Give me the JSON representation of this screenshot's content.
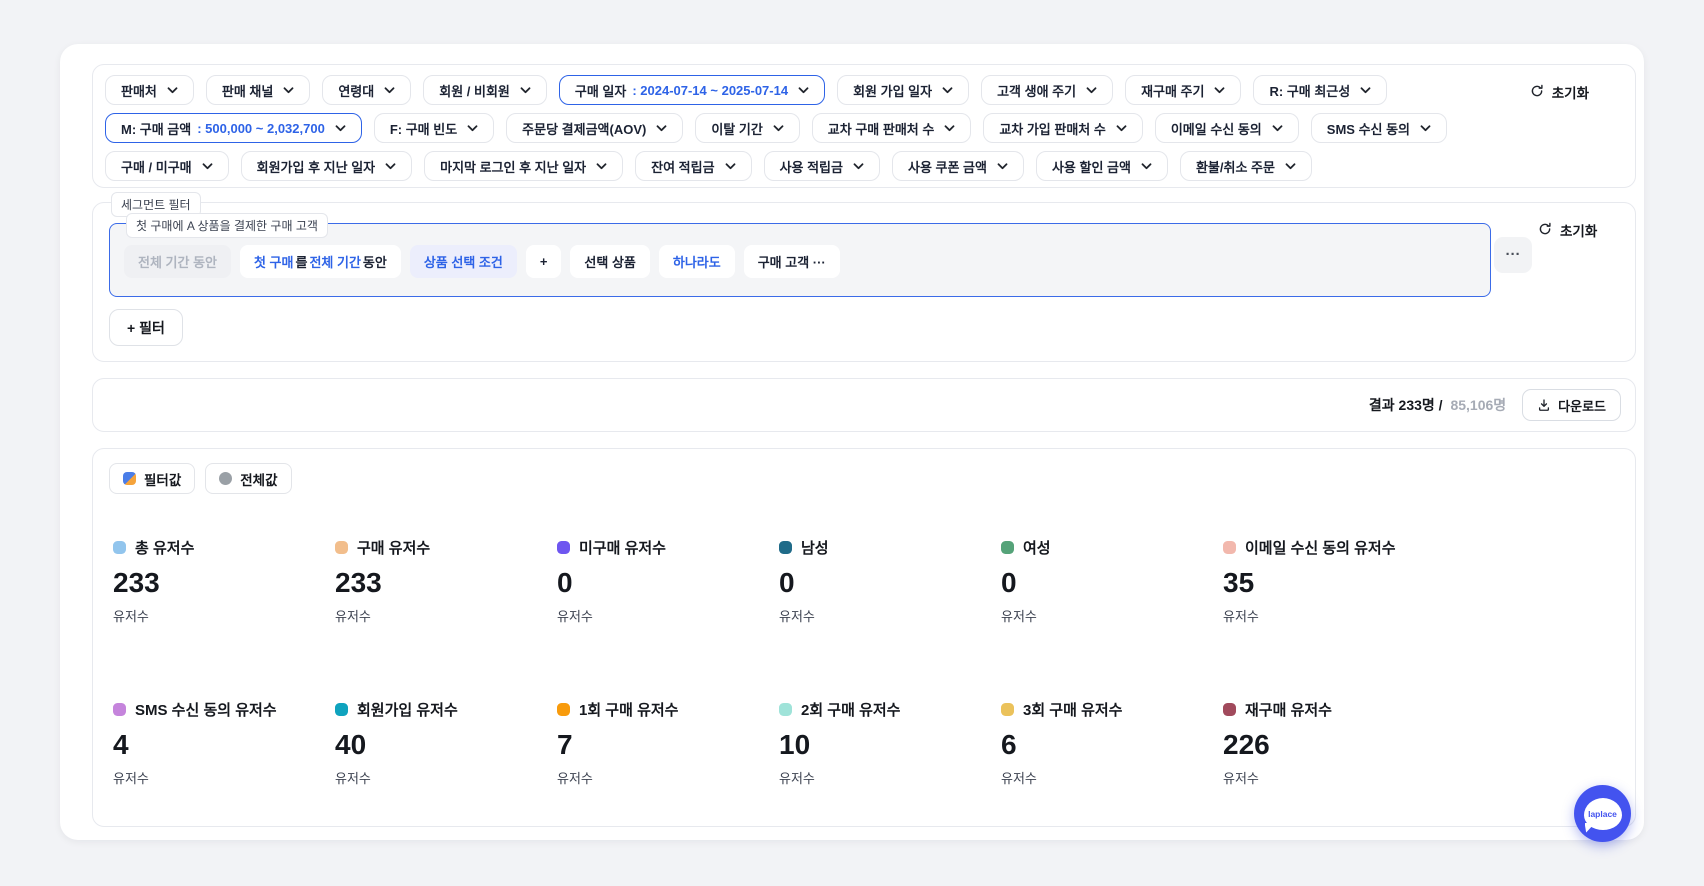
{
  "colors": {
    "accent_blue": "#2E63E7",
    "page_bg": "#F2F3F6",
    "segment_border": "#3B6BE8",
    "chat_fab": "#4353EF"
  },
  "filter_bar": {
    "reset_label": "초기화",
    "rows": [
      [
        {
          "label": "판매처"
        },
        {
          "label": "판매 채널"
        },
        {
          "label": "연령대"
        },
        {
          "label": "회원 / 비회원"
        },
        {
          "label": "구매 일자",
          "value": ": 2024-07-14 ~ 2025-07-14",
          "active": true
        },
        {
          "label": "회원 가입 일자"
        },
        {
          "label": "고객 생애 주기"
        },
        {
          "label": "재구매 주기"
        },
        {
          "label": "R: 구매 최근성"
        }
      ],
      [
        {
          "label": "M: 구매 금액",
          "value": ": 500,000 ~ 2,032,700",
          "active": true
        },
        {
          "label": "F: 구매 빈도"
        },
        {
          "label": "주문당 결제금액(AOV)"
        },
        {
          "label": "이탈 기간"
        },
        {
          "label": "교차 구매 판매처 수"
        },
        {
          "label": "교차 가입 판매처 수"
        },
        {
          "label": "이메일 수신 동의"
        },
        {
          "label": "SMS 수신 동의"
        }
      ],
      [
        {
          "label": "구매 / 미구매"
        },
        {
          "label": "회원가입 후 지난 일자"
        },
        {
          "label": "마지막 로그인 후 지난 일자"
        },
        {
          "label": "잔여 적립금"
        },
        {
          "label": "사용 적립금"
        },
        {
          "label": "사용 쿠폰 금액"
        },
        {
          "label": "사용 할인 금액"
        },
        {
          "label": "환불/취소 주문"
        }
      ]
    ]
  },
  "segment": {
    "section_label": "세그먼트 필터",
    "segment_title": "첫 구매에 A 상품을 결제한 구매 고객",
    "pills": [
      {
        "variant": "disabled",
        "parts": [
          {
            "text": "전체 기간 동안",
            "style": "muted"
          }
        ]
      },
      {
        "variant": "white",
        "parts": [
          {
            "text": "첫 구매",
            "style": "blue"
          },
          {
            "text": "를 ",
            "style": "dark"
          },
          {
            "text": "전체 기간",
            "style": "blue"
          },
          {
            "text": " 동안",
            "style": "dark"
          }
        ]
      },
      {
        "variant": "lavender",
        "parts": [
          {
            "text": "상품 선택 조건",
            "style": "blue"
          }
        ]
      },
      {
        "variant": "white",
        "parts": [
          {
            "text": "+",
            "style": "dark"
          }
        ]
      },
      {
        "variant": "white",
        "parts": [
          {
            "text": "선택 상품",
            "style": "dark"
          }
        ]
      },
      {
        "variant": "white",
        "parts": [
          {
            "text": "하나라도",
            "style": "blue"
          }
        ]
      },
      {
        "variant": "white",
        "parts": [
          {
            "text": "구매 고객 ···",
            "style": "dark"
          }
        ]
      }
    ],
    "more_label": "···",
    "reset_label": "초기화",
    "add_filter_label": "+ 필터"
  },
  "results": {
    "count_label": "결과 233명 /",
    "total_label": "85,106명",
    "download_label": "다운로드"
  },
  "metrics": {
    "legend": [
      {
        "label": "필터값",
        "icon": "split-blue-orange"
      },
      {
        "label": "전체값",
        "icon": "gray"
      }
    ],
    "unit": "유저수",
    "cards": [
      {
        "label": "총 유저수",
        "value": "233",
        "color": "#92C5ED"
      },
      {
        "label": "구매 유저수",
        "value": "233",
        "color": "#F2BE8C"
      },
      {
        "label": "미구매 유저수",
        "value": "0",
        "color": "#6E56F0"
      },
      {
        "label": "남성",
        "value": "0",
        "color": "#206B89"
      },
      {
        "label": "여성",
        "value": "0",
        "color": "#55A379"
      },
      {
        "label": "이메일 수신 동의 유저수",
        "value": "35",
        "color": "#F2B8AD"
      },
      {
        "label": "SMS 수신 동의 유저수",
        "value": "4",
        "color": "#C584DC"
      },
      {
        "label": "회원가입 유저수",
        "value": "40",
        "color": "#0FA3BE"
      },
      {
        "label": "1회 구매 유저수",
        "value": "7",
        "color": "#F89B0C"
      },
      {
        "label": "2회 구매 유저수",
        "value": "10",
        "color": "#9FE3D9"
      },
      {
        "label": "3회 구매 유저수",
        "value": "6",
        "color": "#EBC25B"
      },
      {
        "label": "재구매 유저수",
        "value": "226",
        "color": "#A14A5C"
      }
    ]
  },
  "chat_widget": {
    "label": "laplace"
  }
}
